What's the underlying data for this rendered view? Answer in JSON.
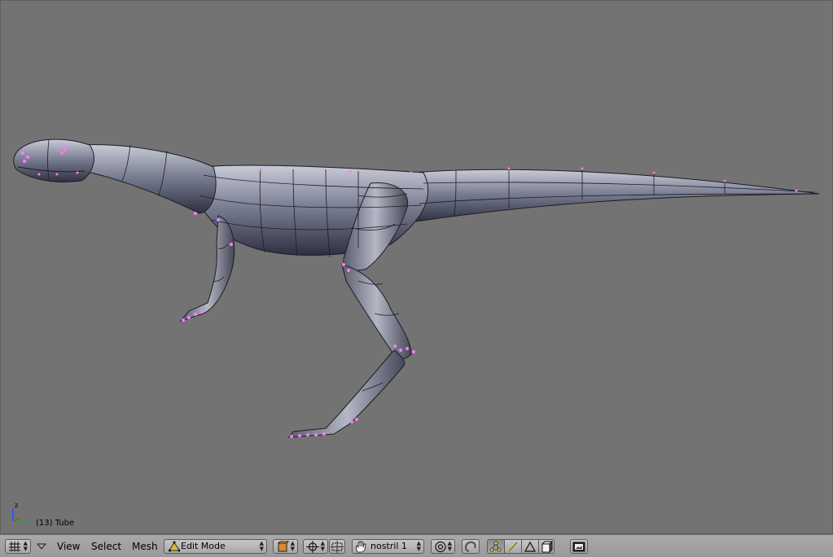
{
  "viewport": {
    "background_color": "#737373",
    "object_label": "(13) Tube",
    "gizmo": {
      "z_axis_label": "z",
      "axis_colors": {
        "x": "#cc3333",
        "y": "#22aa22",
        "z": "#3355ff"
      }
    },
    "model": {
      "mesh_color": "#7b7f92",
      "wire_color": "#1d1d24",
      "selected_vertex_color": "#ff7bff"
    }
  },
  "header": {
    "editor_type_icon": "grid-icon",
    "menus": {
      "view": "View",
      "select": "Select",
      "mesh": "Mesh"
    },
    "mode": {
      "label": "Edit Mode",
      "icon": "triangle-mode-icon"
    },
    "draw_type_icon": "solid-shading-icon",
    "pivot_icon": "pivot-crosshair-icon",
    "manipulator_icon": "manipulator-icon",
    "vertex_group": {
      "icon": "hand-icon",
      "label": "nostril 1"
    },
    "proportional_icon": "proportional-edit-icon",
    "snap_icon": "magnet-icon",
    "select_modes": [
      {
        "name": "vertex-select-mode",
        "active": true
      },
      {
        "name": "edge-select-mode",
        "active": false
      },
      {
        "name": "face-select-mode",
        "active": false
      }
    ],
    "occlude_icon": "occlude-background-icon",
    "render_icon": "render-image-icon"
  }
}
